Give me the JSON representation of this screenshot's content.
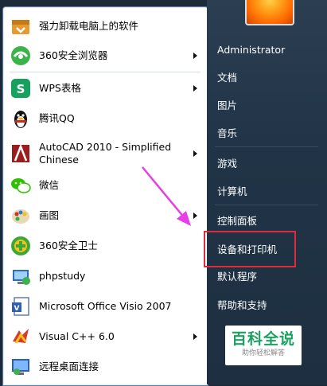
{
  "programs": [
    {
      "label": "强力卸载电脑上的软件",
      "icon": "uninstall-box-icon",
      "submenu": false
    },
    {
      "label": "360安全浏览器",
      "icon": "360-browser-icon",
      "submenu": true
    },
    {
      "label": "WPS表格",
      "icon": "wps-spreadsheet-icon",
      "submenu": true
    },
    {
      "label": "腾讯QQ",
      "icon": "qq-penguin-icon",
      "submenu": false
    },
    {
      "label": "AutoCAD 2010 - Simplified\nChinese",
      "icon": "autocad-icon",
      "submenu": true
    },
    {
      "label": "微信",
      "icon": "wechat-icon",
      "submenu": false
    },
    {
      "label": "画图",
      "icon": "paint-palette-icon",
      "submenu": true
    },
    {
      "label": "360安全卫士",
      "icon": "360-safeguard-icon",
      "submenu": false
    },
    {
      "label": "phpstudy",
      "icon": "phpstudy-icon",
      "submenu": false
    },
    {
      "label": "Microsoft Office Visio 2007",
      "icon": "visio-icon",
      "submenu": false
    },
    {
      "label": "Visual C++ 6.0",
      "icon": "visual-cpp-icon",
      "submenu": true
    },
    {
      "label": "远程桌面连接",
      "icon": "remote-desktop-icon",
      "submenu": false
    }
  ],
  "right_menu": {
    "user": "Administrator",
    "items": [
      "文档",
      "图片",
      "音乐",
      "游戏",
      "计算机",
      "控制面板",
      "设备和打印机",
      "默认程序",
      "帮助和支持"
    ]
  },
  "watermark": {
    "title": "百科全说",
    "subtitle": "助你轻松解答"
  },
  "colors": {
    "highlight": "#e02b3a",
    "arrow": "#e83ee8",
    "watermark_green": "#1aa260"
  }
}
